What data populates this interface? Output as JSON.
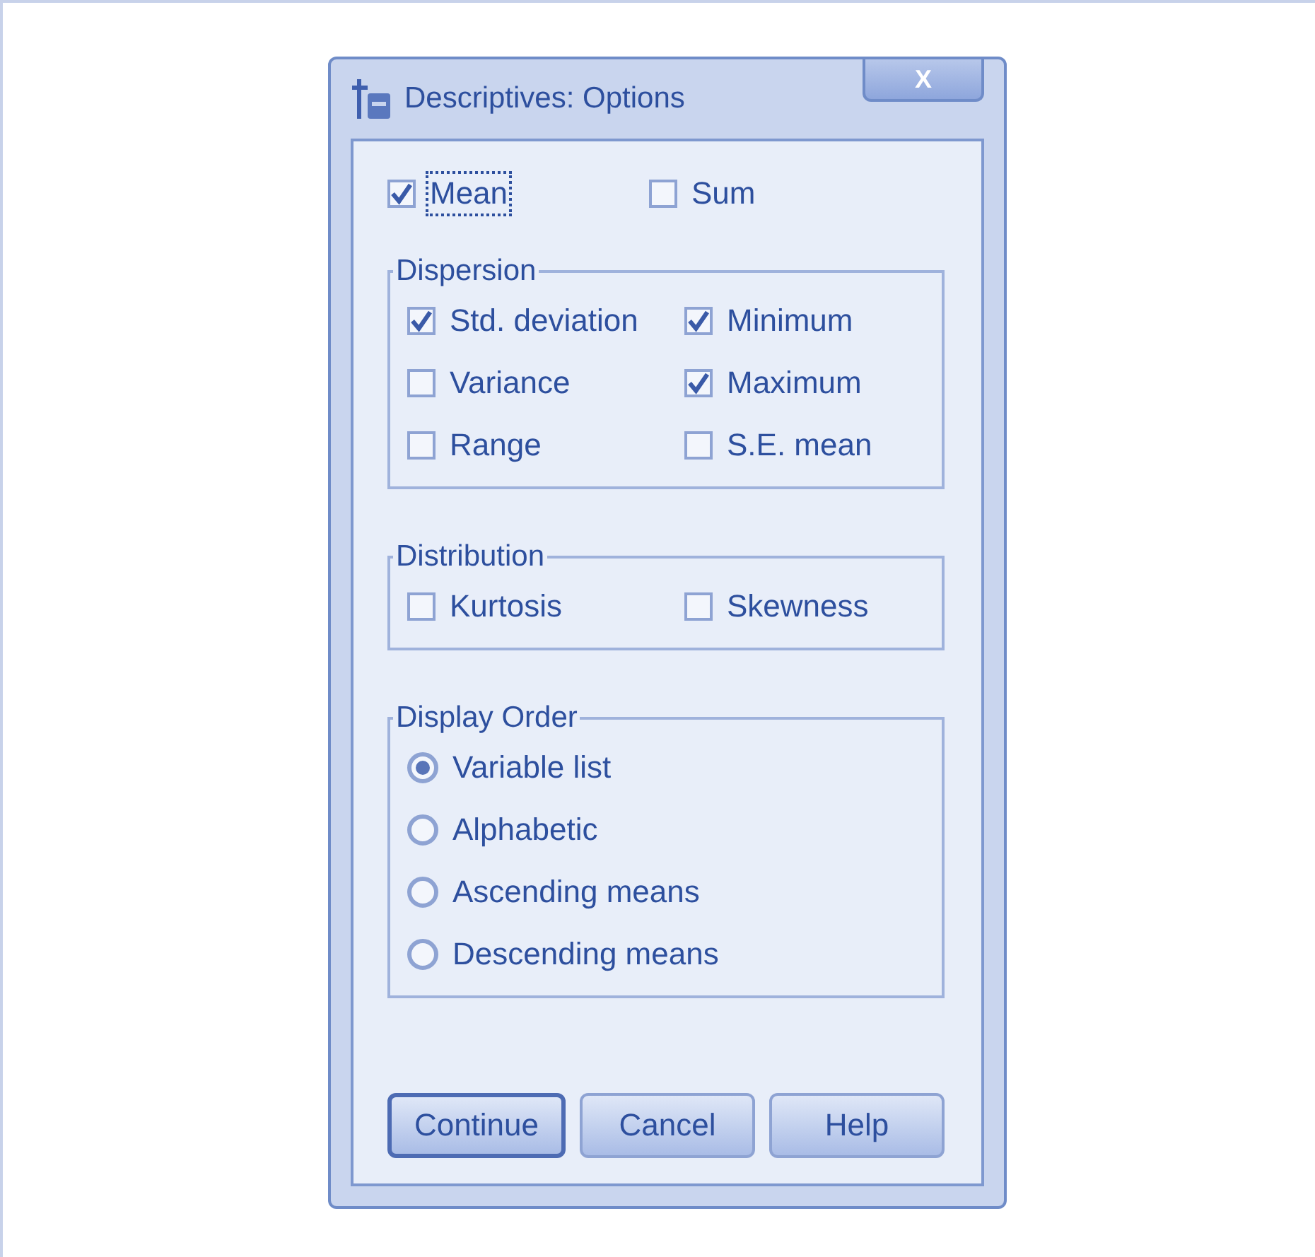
{
  "window": {
    "title": "Descriptives: Options",
    "close": "X"
  },
  "top_options": [
    {
      "label": "Mean",
      "checked": true,
      "focused": true
    },
    {
      "label": "Sum",
      "checked": false,
      "focused": false
    }
  ],
  "groups": [
    {
      "title": "Dispersion",
      "kind": "checkboxes",
      "items": [
        {
          "label": "Std. deviation",
          "checked": true
        },
        {
          "label": "Minimum",
          "checked": true
        },
        {
          "label": "Variance",
          "checked": false
        },
        {
          "label": "Maximum",
          "checked": true
        },
        {
          "label": "Range",
          "checked": false
        },
        {
          "label": "S.E. mean",
          "checked": false
        }
      ]
    },
    {
      "title": "Distribution",
      "kind": "checkboxes",
      "items": [
        {
          "label": "Kurtosis",
          "checked": false
        },
        {
          "label": "Skewness",
          "checked": false
        }
      ]
    },
    {
      "title": "Display Order",
      "kind": "radios",
      "items": [
        {
          "label": "Variable list",
          "selected": true
        },
        {
          "label": "Alphabetic",
          "selected": false
        },
        {
          "label": "Ascending means",
          "selected": false
        },
        {
          "label": "Descending means",
          "selected": false
        }
      ]
    }
  ],
  "buttons": [
    {
      "label": "Continue",
      "default": true
    },
    {
      "label": "Cancel",
      "default": false
    },
    {
      "label": "Help",
      "default": false
    }
  ]
}
